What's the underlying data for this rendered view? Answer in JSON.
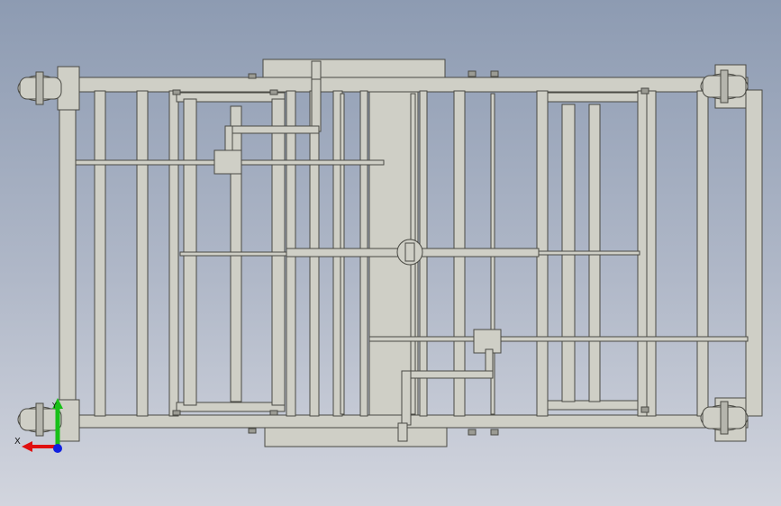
{
  "view": {
    "background_top": "#8d9bb2",
    "background_bottom": "#d2d5de",
    "part_fill": "#cfcfc6",
    "part_stroke": "#4a4a44",
    "part_shadow": "#b7b7ae"
  },
  "triad": {
    "x_label": "X",
    "y_label": "Y",
    "x_color": "#e01010",
    "y_color": "#18c018",
    "z_color": "#1020e0"
  }
}
